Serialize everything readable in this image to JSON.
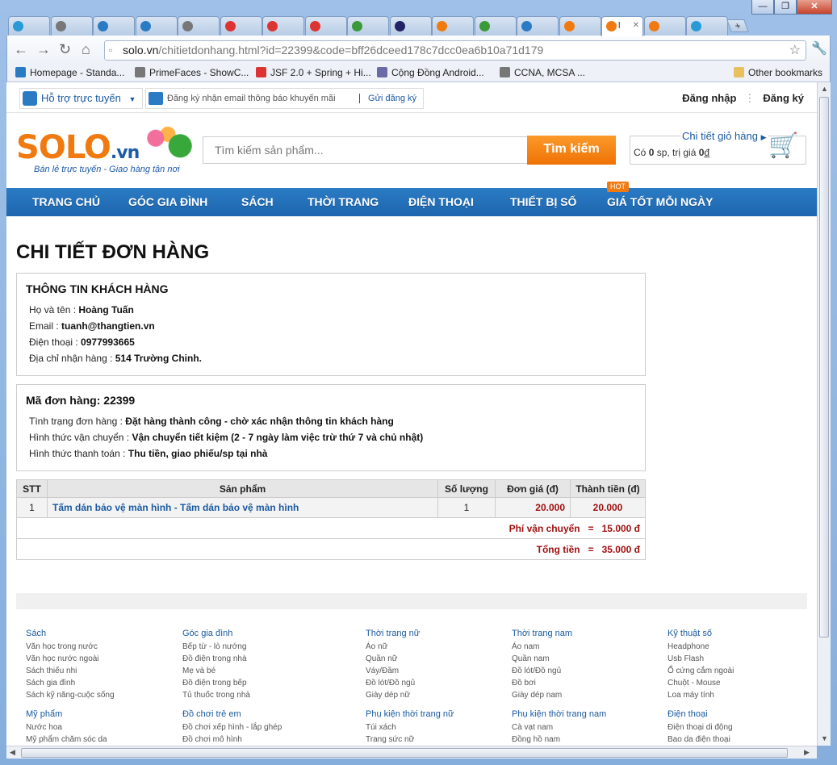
{
  "browser": {
    "window_controls": [
      "—",
      "❐",
      "✕"
    ],
    "tabs": [
      {
        "label": "",
        "color": "#2a9ad6"
      },
      {
        "label": "",
        "color": "#777"
      },
      {
        "label": "",
        "color": "#2a7bc4"
      },
      {
        "label": "",
        "color": "#2a7bc4"
      },
      {
        "label": "",
        "color": "#777"
      },
      {
        "label": "",
        "color": "#d33"
      },
      {
        "label": "",
        "color": "#d33"
      },
      {
        "label": "",
        "color": "#d33"
      },
      {
        "label": "",
        "color": "#3a9a3a"
      },
      {
        "label": "",
        "color": "#226"
      },
      {
        "label": "",
        "color": "#f07a10"
      },
      {
        "label": "",
        "color": "#3a9a3a"
      },
      {
        "label": "",
        "color": "#2a7bc4"
      },
      {
        "label": "",
        "color": "#f07a10"
      },
      {
        "label": "l",
        "color": "#f07a10",
        "active": true
      },
      {
        "label": "",
        "color": "#f07a10"
      },
      {
        "label": "",
        "color": "#2a9ad6"
      }
    ],
    "new_tab": "+",
    "url_host": "solo.vn",
    "url_path": "/chitietdonhang.html?id=22399&code=bff26dceed178c7dcc0ea6b10a71d179",
    "bookmarks": [
      {
        "label": "Homepage - Standa...",
        "color": "#2a7bc4"
      },
      {
        "label": "PrimeFaces - ShowC...",
        "color": "#777"
      },
      {
        "label": "JSF 2.0 + Spring + Hi...",
        "color": "#d33"
      },
      {
        "label": "Cộng Đồng Android...",
        "color": "#6a6aa8"
      },
      {
        "label": "CCNA, MCSA ...",
        "color": "#777"
      }
    ],
    "other_bookmarks": "Other bookmarks"
  },
  "site": {
    "support_label": "Hỗ trợ trực tuyến",
    "newsletter_placeholder": "Đăng ký nhận email thông báo khuyến mãi",
    "newsletter_submit": "Gửi đăng ký",
    "login": "Đăng nhập",
    "register": "Đăng ký",
    "logo_text": "SOLO",
    "logo_suffix": ".vn",
    "slogan": "Bán lẻ trực tuyến - Giao hàng tận nơi",
    "search_placeholder": "Tìm kiếm sản phẩm...",
    "search_button": "Tìm kiếm",
    "cart_link": "Chi tiết giỏ hàng",
    "cart_prefix": "Có ",
    "cart_count": "0",
    "cart_mid": " sp, trị giá ",
    "cart_value": "0",
    "cart_currency": "đ",
    "menu": [
      "TRANG CHỦ",
      "GÓC GIA ĐÌNH",
      "SÁCH",
      "THỜI TRANG",
      "ĐIỆN THOẠI",
      "THIẾT BỊ SỐ",
      "GIÁ TỐT MỖI NGÀY"
    ],
    "hot_badge": "HOT",
    "brand_colors": {
      "blue": "#2a7bc4",
      "orange": "#f07a10",
      "price": "#a01010"
    }
  },
  "order": {
    "page_title": "CHI TIẾT ĐƠN HÀNG",
    "customer_heading": "THÔNG TIN KHÁCH HÀNG",
    "name_label": "Họ và tên : ",
    "name": "Hoàng Tuấn",
    "email_label": "Email : ",
    "email": "tuanh@thangtien.vn",
    "phone_label": "Điện thoại : ",
    "phone": "0977993665",
    "address_label": "Địa chỉ nhận hàng : ",
    "address": "514 Trường Chinh.",
    "code_heading": "Mã đơn hàng: 22399",
    "status_label": "Tình trạng đơn hàng : ",
    "status": "Đặt hàng thành công - chờ xác nhận thông tin khách hàng",
    "shipping_label": "Hình thức vận chuyển : ",
    "shipping": "Vận chuyển tiết kiệm (2 - 7 ngày làm việc trừ thứ 7 và chủ nhật)",
    "payment_label": "Hình thức thanh toán : ",
    "payment": "Thu tiền, giao phiếu/sp tại nhà",
    "columns": [
      "STT",
      "Sản phẩm",
      "Số lượng",
      "Đơn giá (đ)",
      "Thành tiền (đ)"
    ],
    "items": [
      {
        "stt": "1",
        "product": "Tấm dán bảo vệ màn hình - Tấm dán bảo vệ màn hình",
        "qty": "1",
        "unit_price": "20.000",
        "total": "20.000"
      }
    ],
    "shipping_fee": "Phí vận chuyển   =   15.000 đ",
    "grand_total": "Tổng tiền   =   35.000 đ"
  },
  "footer": {
    "columns": [
      {
        "title": "Sách",
        "items": [
          "Văn học trong nước",
          "Văn học nước ngoài",
          "Sách thiếu nhi",
          "Sách gia đình",
          "Sách kỹ năng-cuộc sống"
        ],
        "title2": "Mỹ phẩm",
        "items2": [
          "Nước hoa",
          "Mỹ phẩm chăm sóc da"
        ]
      },
      {
        "title": "Góc gia đình",
        "items": [
          "Bếp từ - lò nướng",
          "Đồ điện trong nhà",
          "Mẹ và bé",
          "Đồ điện trong bếp",
          "Tủ thuốc trong nhà"
        ],
        "title2": "Đồ chơi trẻ em",
        "items2": [
          "Đồ chơi xếp hình - lắp ghép",
          "Đồ chơi mô hình"
        ]
      },
      {
        "title": "Thời trang nữ",
        "items": [
          "Áo nữ",
          "Quần nữ",
          "Váy/Đầm",
          "Đồ lót/Đồ ngủ",
          "Giày dép nữ"
        ],
        "title2": "Phụ kiện thời trang nữ",
        "items2": [
          "Túi xách",
          "Trang sức nữ"
        ]
      },
      {
        "title": "Thời trang nam",
        "items": [
          "Áo nam",
          "Quần nam",
          "Đồ lót/Đồ ngủ",
          "Đồ bơi",
          "Giày dép nam"
        ],
        "title2": "Phụ kiện thời trang nam",
        "items2": [
          "Cà vạt nam",
          "Đồng hồ nam"
        ]
      },
      {
        "title": "Kỹ thuật số",
        "items": [
          "Headphone",
          "Usb Flash",
          "Ổ cứng cắm ngoài",
          "Chuột - Mouse",
          "Loa máy tính"
        ],
        "title2": "Điện thoại",
        "items2": [
          "Điện thoại di động",
          "Bao da điện thoại"
        ]
      }
    ]
  }
}
